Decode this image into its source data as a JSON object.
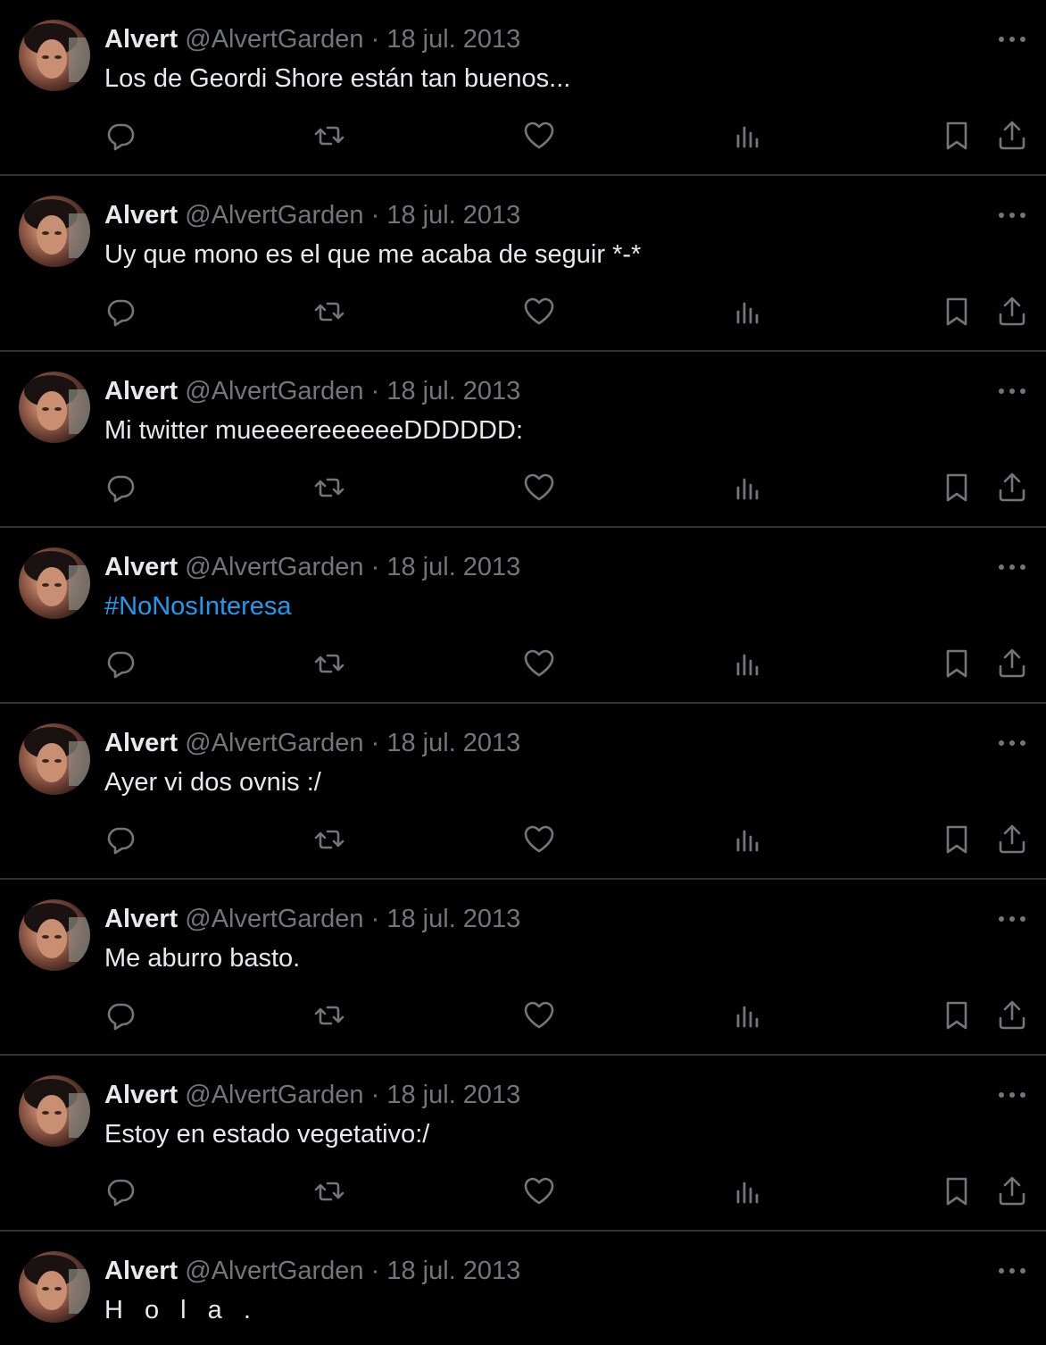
{
  "colors": {
    "background": "#000000",
    "primary_text": "#e7e9ea",
    "secondary_text": "#71767b",
    "divider": "#2f3336",
    "link": "#1d9bf0"
  },
  "icons": {
    "more": "more-horizontal-icon",
    "reply": "reply-icon",
    "retweet": "retweet-icon",
    "like": "heart-icon",
    "views": "views-bar-chart-icon",
    "bookmark": "bookmark-icon",
    "share": "share-icon"
  },
  "tweets": [
    {
      "name": "Alvert",
      "handle": "@AlvertGarden",
      "separator": "·",
      "date": "18 jul. 2013",
      "text": "Los de Geordi Shore están tan buenos..."
    },
    {
      "name": "Alvert",
      "handle": "@AlvertGarden",
      "separator": "·",
      "date": "18 jul. 2013",
      "text": "Uy que mono es el que me acaba de seguir *-*"
    },
    {
      "name": "Alvert",
      "handle": "@AlvertGarden",
      "separator": "·",
      "date": "18 jul. 2013",
      "text": "Mi twitter mueeeereeeeeeDDDDDD:"
    },
    {
      "name": "Alvert",
      "handle": "@AlvertGarden",
      "separator": "·",
      "date": "18 jul. 2013",
      "text": "#NoNosInteresa"
    },
    {
      "name": "Alvert",
      "handle": "@AlvertGarden",
      "separator": "·",
      "date": "18 jul. 2013",
      "text": "Ayer vi dos ovnis :/"
    },
    {
      "name": "Alvert",
      "handle": "@AlvertGarden",
      "separator": "·",
      "date": "18 jul. 2013",
      "text": "Me aburro basto."
    },
    {
      "name": "Alvert",
      "handle": "@AlvertGarden",
      "separator": "·",
      "date": "18 jul. 2013",
      "text": "Estoy en estado vegetativo:/"
    },
    {
      "name": "Alvert",
      "handle": "@AlvertGarden",
      "separator": "·",
      "date": "18 jul. 2013",
      "text": "H o l a ."
    }
  ]
}
